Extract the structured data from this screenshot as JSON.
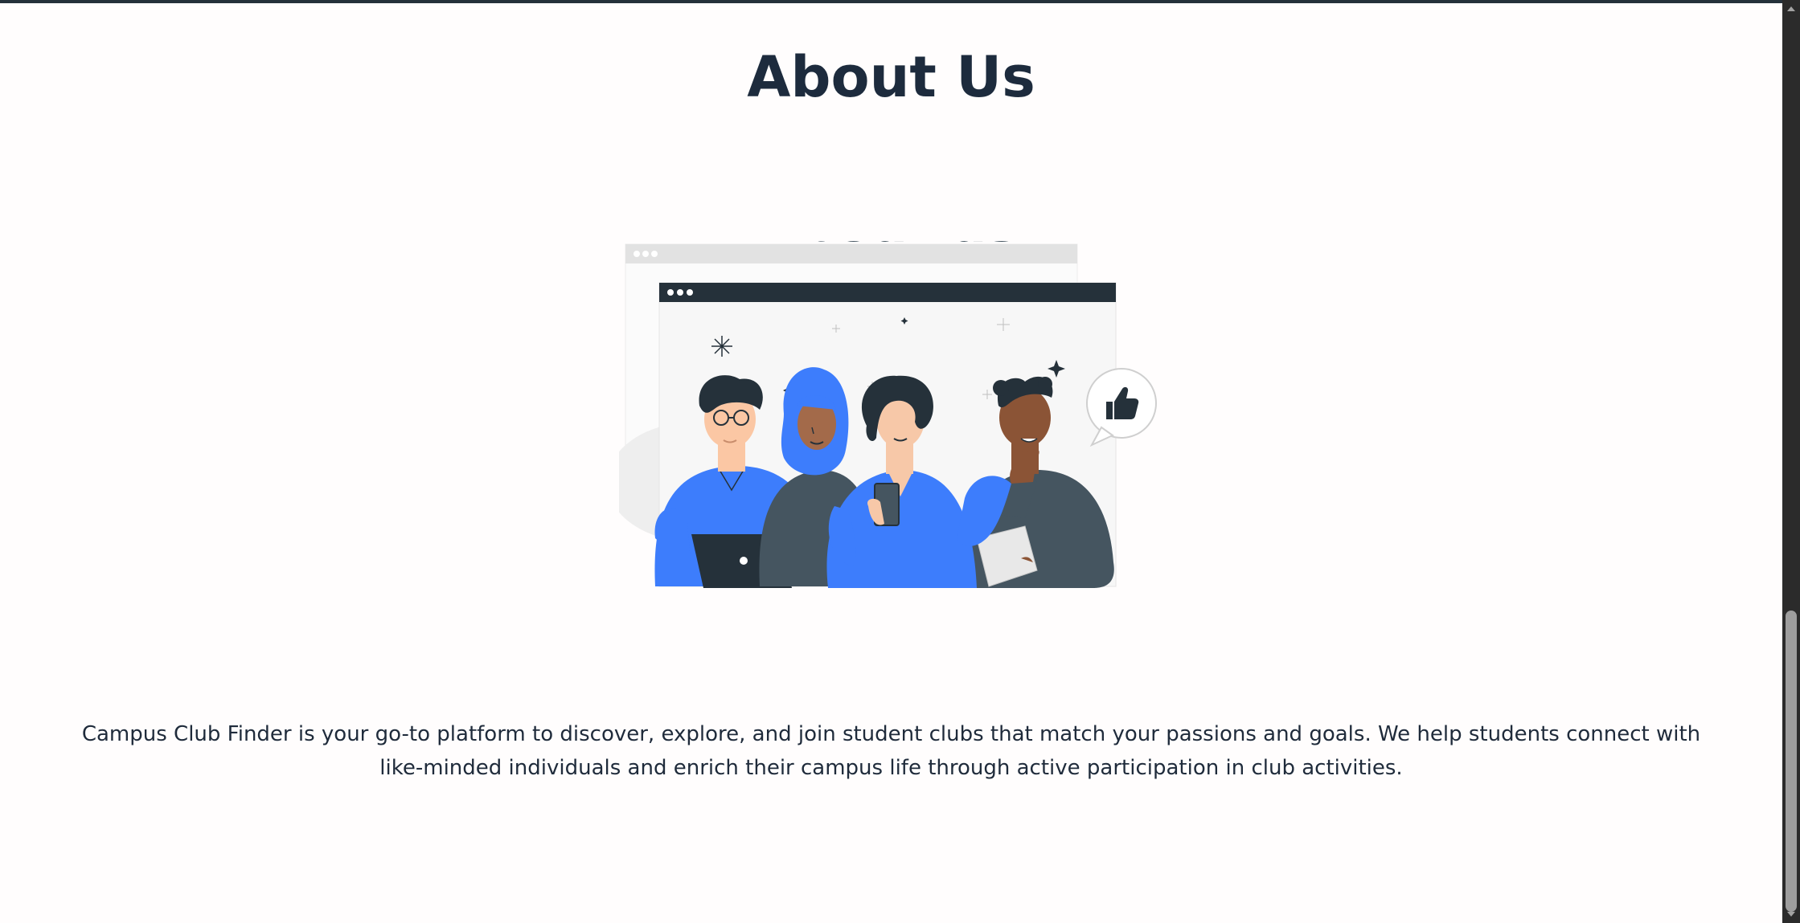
{
  "page": {
    "title": "About Us",
    "description": "Campus Club Finder is your go-to platform to discover, explore, and join student clubs that match your passions and goals. We help students connect with like-minded individuals and enrich their campus life through active participation in club activities."
  },
  "illustration": {
    "banner_text": "About us",
    "icon": "thumbs-up-icon"
  },
  "colors": {
    "heading": "#1d2b3d",
    "accent_blue": "#3d7dfc",
    "dark_gray": "#455560",
    "window_bar": "#25313a"
  }
}
